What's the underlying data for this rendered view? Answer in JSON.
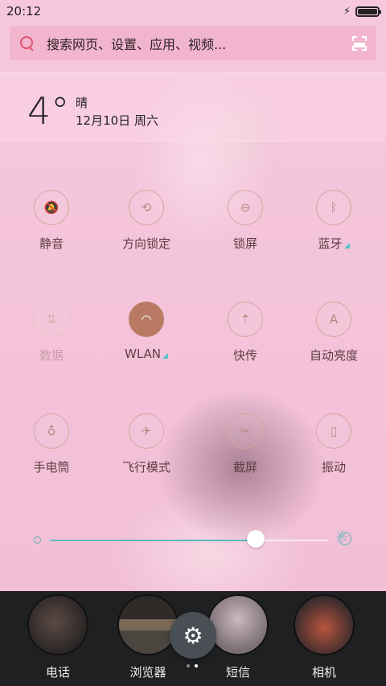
{
  "status": {
    "time": "20:12",
    "charging": "bolt-icon"
  },
  "search": {
    "placeholder": "搜索网页、设置、应用、视频..."
  },
  "weather": {
    "temp": "4°",
    "condition": "晴",
    "date": "12月10日 周六"
  },
  "toggles": [
    {
      "label": "静音",
      "icon": "bell-off-icon",
      "glyph": "🔕",
      "state": "off"
    },
    {
      "label": "方向锁定",
      "icon": "rotation-lock-icon",
      "glyph": "⟲",
      "state": "off"
    },
    {
      "label": "锁屏",
      "icon": "lock-icon",
      "glyph": "⊖",
      "state": "off"
    },
    {
      "label": "蓝牙",
      "icon": "bluetooth-icon",
      "glyph": "ᛒ",
      "state": "off",
      "more": true
    },
    {
      "label": "数据",
      "icon": "data-icon",
      "glyph": "⇅",
      "state": "disabled"
    },
    {
      "label": "WLAN",
      "icon": "wifi-icon",
      "glyph": "◠",
      "state": "on",
      "more": true
    },
    {
      "label": "快传",
      "icon": "transfer-icon",
      "glyph": "⇡",
      "state": "off"
    },
    {
      "label": "自动亮度",
      "icon": "auto-brightness-icon",
      "glyph": "A",
      "state": "off"
    },
    {
      "label": "手电筒",
      "icon": "flashlight-icon",
      "glyph": "♁",
      "state": "off"
    },
    {
      "label": "飞行模式",
      "icon": "airplane-icon",
      "glyph": "✈",
      "state": "off"
    },
    {
      "label": "截屏",
      "icon": "screenshot-icon",
      "glyph": "✂",
      "state": "off"
    },
    {
      "label": "振动",
      "icon": "vibrate-icon",
      "glyph": "▯",
      "state": "off"
    }
  ],
  "brightness": {
    "level": 0.74
  },
  "dock": [
    {
      "label": "电话",
      "icon": "phone-app-icon"
    },
    {
      "label": "浏览器",
      "icon": "browser-app-icon"
    },
    {
      "label": "短信",
      "icon": "sms-app-icon"
    },
    {
      "label": "相机",
      "icon": "camera-app-icon"
    }
  ],
  "settings_button": {
    "icon": "gear-icon",
    "glyph": "⚙"
  },
  "page_indicator": {
    "pages": 2,
    "current": 2
  }
}
